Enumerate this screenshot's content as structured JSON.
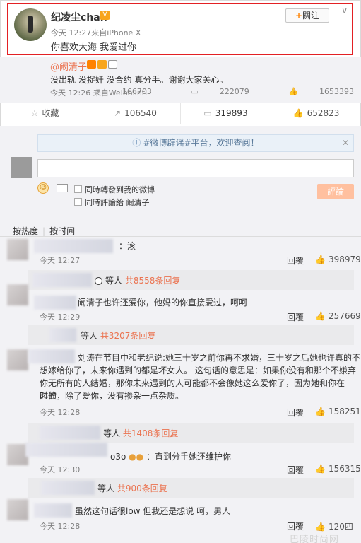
{
  "post": {
    "user_name": "纪凌尘chan",
    "follow_label": "關注",
    "meta": "今天 12:27来自iPhone X",
    "text": "你喜欢大海 我爱过你"
  },
  "repost": {
    "user_name": "@阚清子",
    "text": "没出轨 没捉奸 没合约 真分手。谢谢大家关心。",
    "meta": "今天 12:26 来自Weibo.intl",
    "shares": "166703",
    "comments": "222079",
    "likes": "1653393"
  },
  "actions": {
    "favorite": "收藏",
    "share": "106540",
    "comment": "319893",
    "like": "652823"
  },
  "notice": "#微博辟谣#平台，欢迎查阅！",
  "composer": {
    "repost_to_my_weibo": "同時轉發到我的微博",
    "comment_to": "同時評論給 阚清子",
    "submit": "評論"
  },
  "sort": {
    "hot": "按热度",
    "time": "按时间"
  },
  "comments": [
    {
      "text": "：滚",
      "time": "今天 12:27",
      "reply": "回覆",
      "likes": "398979",
      "sub": {
        "who": "等人",
        "link": "共8558条回复"
      }
    },
    {
      "text": "阚清子也许还爱你，他妈的你直接爱过，呵呵",
      "time": "今天 12:29",
      "reply": "回覆",
      "likes": "257669",
      "sub": {
        "who": "等人",
        "link": "共3207条回复"
      }
    },
    {
      "text_lines": [
        "刘涛在节目中和老纪说:她三十岁之前你再不求婚，三十岁之后她也许真的不",
        "想嫁给你了，未来你遇到的都是坏女人。  这句话的意思是：如果你没有和那个不嫌弃你",
        "一无所有的人结婚，那你未来遇到的人可能都不会像她这么爱你了，因为她和你在一起的",
        "时候，除了爱你，没有掺杂一点杂质。"
      ],
      "time": "今天 12:28",
      "reply": "回覆",
      "likes": "158251",
      "sub": {
        "who": "等人",
        "link": "共1408条回复"
      }
    },
    {
      "text": "o3o",
      "text2": "：直到分手她还维护你",
      "time": "今天 12:30",
      "reply": "回覆",
      "likes": "156315",
      "sub": {
        "who": "等人",
        "link": "共900条回复"
      }
    },
    {
      "text": "虽然这句话很low  但我还是想说  呵，男人",
      "time": "今天 12:28",
      "reply": "回覆",
      "likes": "120四"
    }
  ],
  "watermark": "巴陵时尚网",
  "colors": {
    "highlight_border": "#e32024",
    "link_orange": "#eb7350",
    "gray_bg": "#f2f2f5",
    "submit_bg": "#ffc09f"
  }
}
